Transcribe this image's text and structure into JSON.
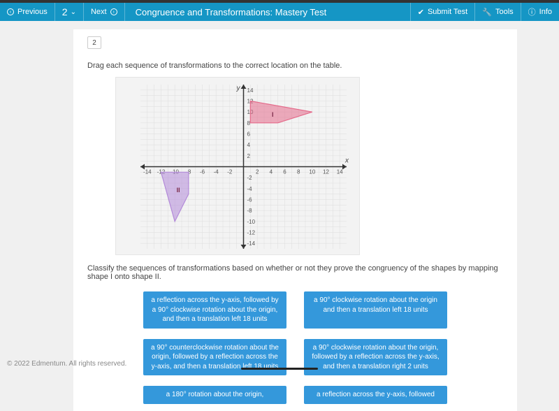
{
  "topbar": {
    "prev": "Previous",
    "q": "2",
    "next": "Next",
    "title": "Congruence and Transformations: Mastery Test",
    "submit": "Submit Test",
    "tools": "Tools",
    "info": "Info"
  },
  "question": {
    "num": "2",
    "instruction": "Drag each sequence of transformations to the correct location on the table.",
    "classify": "Classify the sequences of transformations based on whether or not they prove the congruency of the shapes by mapping shape I onto shape II."
  },
  "tiles": [
    "a reflection across the y-axis, followed by a 90° clockwise rotation about the origin, and then a translation left 18 units",
    "a 90° clockwise rotation about the origin and then a translation left 18 units",
    "a 90° counterclockwise rotation about the origin, followed by a reflection across the y-axis, and then a translation left 18 units",
    "a 90° clockwise rotation about the origin, followed by a reflection across the y-axis, and then a translation right 2 units",
    "a 180° rotation about the origin,",
    "a reflection across the y-axis, followed"
  ],
  "footer": "© 2022 Edmentum. All rights reserved.",
  "chart_data": {
    "type": "scatter",
    "title": "",
    "xlabel": "x",
    "ylabel": "y",
    "xlim": [
      -15,
      15
    ],
    "ylim": [
      -15,
      15
    ],
    "xticks": [
      -14,
      -12,
      -10,
      -8,
      -6,
      -4,
      -2,
      2,
      4,
      6,
      8,
      10,
      12,
      14
    ],
    "yticks": [
      -14,
      -12,
      -10,
      -8,
      -6,
      -4,
      -2,
      2,
      4,
      6,
      8,
      10,
      12,
      14
    ],
    "series": [
      {
        "name": "I",
        "type": "polygon",
        "color": "#e46a8a",
        "points": [
          [
            1,
            8
          ],
          [
            1,
            12
          ],
          [
            10,
            10
          ],
          [
            5,
            8
          ]
        ]
      },
      {
        "name": "II",
        "type": "polygon",
        "color": "#b38ad9",
        "points": [
          [
            -8,
            -1
          ],
          [
            -8,
            -5
          ],
          [
            -10,
            -10
          ],
          [
            -12,
            -1
          ]
        ]
      }
    ]
  }
}
